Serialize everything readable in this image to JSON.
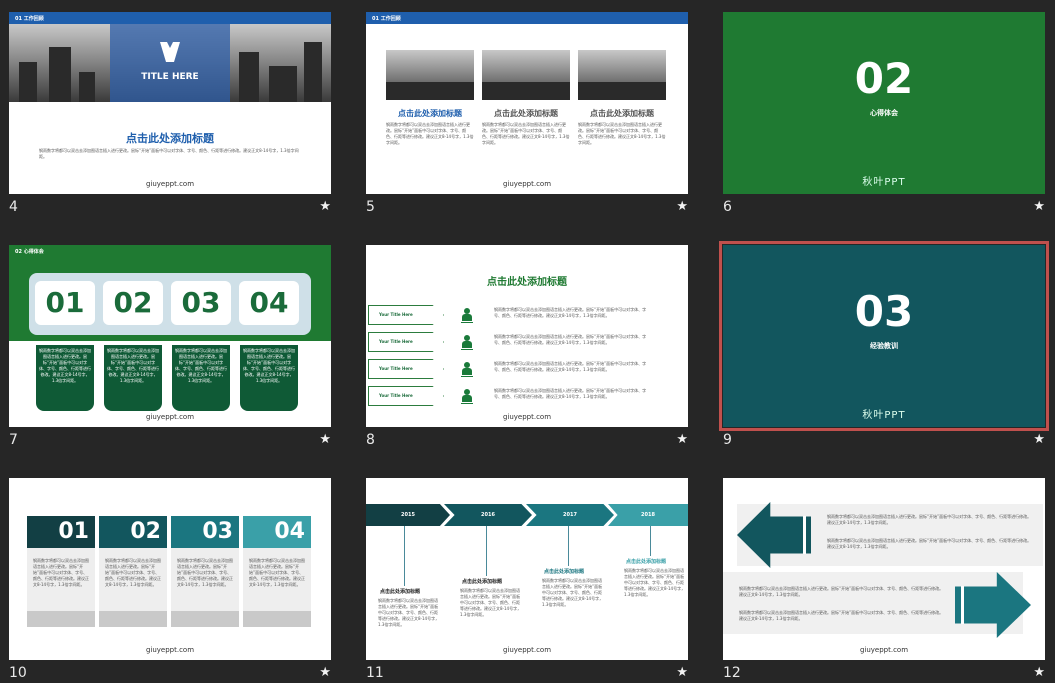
{
  "slides": [
    {
      "number": "4",
      "star": "★",
      "header": "01 工作回顾",
      "hero_title": "TITLE HERE",
      "title": "点击此处添加标题",
      "body": "钢雨数字将都可以双击去添加图语言插入进行更改。鼠标“开始”面板中可以对字体、字号、颜色、行距等进行修改。建议正文8-14号字，1.3倍字间距。",
      "footer": "giuyeppt.com"
    },
    {
      "number": "5",
      "star": "★",
      "header": "01 工作回顾",
      "cards": [
        {
          "title": "点击此处添加标题",
          "body": "钢雨数字将都可以双击去添加图语言插入进行更改。鼠标“开始”面板中可以对字体、字号、颜色、行距等进行修改。建议正文8-14号字，1.3倍字间距。"
        },
        {
          "title": "点击此处添加标题",
          "body": "钢雨数字将都可以双击去添加图语言插入进行更改。鼠标“开始”面板中可以对字体、字号、颜色、行距等进行修改。建议正文8-14号字，1.3倍字间距。"
        },
        {
          "title": "点击此处添加标题",
          "body": "钢雨数字将都可以双击去添加图语言插入进行更改。鼠标“开始”面板中可以对字体、字号、颜色、行距等进行修改。建议正文8-14号字，1.3倍字间距。"
        }
      ],
      "footer": "giuyeppt.com"
    },
    {
      "number": "6",
      "star": "★",
      "big": "02",
      "subtitle": "心得体会",
      "logo": "秋叶PPT"
    },
    {
      "number": "7",
      "star": "★",
      "header": "02 心得体会",
      "tiles": [
        "01",
        "02",
        "03",
        "04"
      ],
      "body": "钢雨数字将都可以双击去添加图语言插入进行更改。鼠标“开始”面板中可以对字体、字号、颜色、行距等进行修改。建议正文8-14号字，1.3倍字间距。",
      "footer": "giuyeppt.com"
    },
    {
      "number": "8",
      "star": "★",
      "title": "点击此处添加标题",
      "rows": [
        "Your Title Here",
        "Your Title Here",
        "Your Title Here",
        "Your Title Here"
      ],
      "body": "钢雨数字将都可以双击去添加图语言插入进行更改。鼠标“开始”面板中可以对字体、字号、颜色、行距等进行修改。建议正文8-14号字，1.3倍字间距。",
      "footer": "giuyeppt.com"
    },
    {
      "number": "9",
      "star": "★",
      "big": "03",
      "subtitle": "经验教训",
      "logo": "秋叶PPT"
    },
    {
      "number": "10",
      "star": "★",
      "tiles": [
        "01",
        "02",
        "03",
        "04"
      ],
      "body": "钢雨数字将都可以双击去添加图语言插入进行更改。鼠标“开始”面板中可以对字体、字号、颜色、行距等进行修改。建议正文8-14号字，1.3倍字间距。",
      "footer": "giuyeppt.com"
    },
    {
      "number": "11",
      "star": "★",
      "years": [
        "2015",
        "2016",
        "2017",
        "2018"
      ],
      "title": "点击此处添加标题",
      "body": "钢雨数字将都可以双击去添加图语言插入进行更改。鼠标“开始”面板中可以对字体、字号、颜色、行距等进行修改。建议正文8-14号字，1.3倍字间距。",
      "footer": "giuyeppt.com"
    },
    {
      "number": "12",
      "star": "★",
      "body": "钢雨数字将都可以双击去添加图语言插入进行更改。鼠标“开始”面板中可以对字体、字号、颜色、行距等进行修改。建议正文8-14号字，1.3倍字间距。",
      "footer": "giuyeppt.com"
    }
  ],
  "colors": {
    "green": "#1f7a32",
    "teal": "#12565e",
    "blue": "#1f5fad",
    "selected_border": "#c0504d",
    "background": "#262626"
  },
  "selected_slide": "9"
}
